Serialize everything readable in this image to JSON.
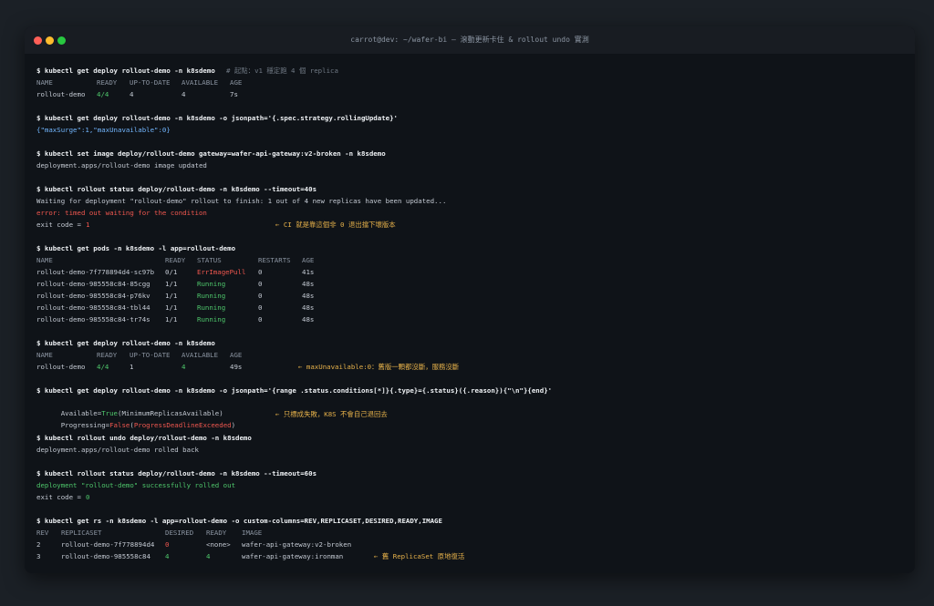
{
  "window": {
    "title": "carrot@dev: ~/wafer-bi — 滾動更新卡住 & rollout undo 實測"
  },
  "commands": {
    "c1": "$ kubectl get deploy rollout-demo -n k8sdemo",
    "c1_comment": "# 起點：v1 穩定跑 4 個 replica",
    "c2": "$ kubectl get deploy rollout-demo -n k8sdemo -o jsonpath='{.spec.strategy.rollingUpdate}'",
    "c3": "$ kubectl set image deploy/rollout-demo gateway=wafer-api-gateway:v2-broken -n k8sdemo",
    "c4": "$ kubectl rollout status deploy/rollout-demo -n k8sdemo --timeout=40s",
    "c5": "$ kubectl get pods -n k8sdemo -l app=rollout-demo",
    "c6": "$ kubectl get deploy rollout-demo -n k8sdemo",
    "c7": "$ kubectl get deploy rollout-demo -n k8sdemo -o jsonpath='{range .status.conditions[*]}{.type}={.status}({.reason}){\"\\n\"}{end}'",
    "c8": "$ kubectl rollout undo deploy/rollout-demo -n k8sdemo",
    "c9": "$ kubectl rollout status deploy/rollout-demo -n k8sdemo --timeout=60s",
    "c10": "$ kubectl get rs -n k8sdemo -l app=rollout-demo -o custom-columns=REV,REPLICASET,DESIRED,READY,IMAGE"
  },
  "deploy_table": {
    "headers": [
      "NAME",
      "READY",
      "UP-TO-DATE",
      "AVAILABLE",
      "AGE"
    ],
    "row1": [
      "rollout-demo",
      "4/4",
      "4",
      "4",
      "7s"
    ],
    "row2": [
      "rollout-demo",
      "4/4",
      "1",
      "4",
      "49s"
    ],
    "row2_annotation": "← maxUnavailable:0：舊版一顆都沒斷，服務沒斷"
  },
  "outputs": {
    "strategy_json": "{\"maxSurge\":1,\"maxUnavailable\":0}",
    "image_updated": "deployment.apps/rollout-demo image updated",
    "waiting": "Waiting for deployment \"rollout-demo\" rollout to finish: 1 out of 4 new replicas have been updated...",
    "error": "error: timed out waiting for the condition",
    "exit_label": "exit code = ",
    "exit1_value": "1",
    "exit1_annotation": "← CI 就是靠這個非 0 退出擋下壞版本",
    "cond_available_key": "Available=",
    "cond_available_status": "True",
    "cond_available_reason": "(MinimumReplicasAvailable)",
    "cond_progress_key": "Progressing=",
    "cond_progress_status": "False",
    "cond_progress_open": "(",
    "cond_progress_reason": "ProgressDeadlineExceeded",
    "cond_progress_close": ")",
    "cond_annotation": "← 只標成失敗，K8S 不會自己退回去",
    "rolled_back": "deployment.apps/rollout-demo rolled back",
    "rolled_out": "deployment \"rollout-demo\" successfully rolled out",
    "exit0_value": "0"
  },
  "pods_table": {
    "headers": [
      "NAME",
      "READY",
      "STATUS",
      "RESTARTS",
      "AGE"
    ],
    "rows": [
      [
        "rollout-demo-7f778894d4-sc97b",
        "0/1",
        "ErrImagePull",
        "0",
        "41s"
      ],
      [
        "rollout-demo-985558c84-85cgg",
        "1/1",
        "Running",
        "0",
        "48s"
      ],
      [
        "rollout-demo-985558c84-p76kv",
        "1/1",
        "Running",
        "0",
        "48s"
      ],
      [
        "rollout-demo-985558c84-tbl44",
        "1/1",
        "Running",
        "0",
        "48s"
      ],
      [
        "rollout-demo-985558c84-tr74s",
        "1/1",
        "Running",
        "0",
        "48s"
      ]
    ]
  },
  "rs_table": {
    "headers": [
      "REV",
      "REPLICASET",
      "DESIRED",
      "READY",
      "IMAGE"
    ],
    "rows": [
      [
        "2",
        "rollout-demo-7f778894d4",
        "0",
        "<none>",
        "wafer-api-gateway:v2-broken"
      ],
      [
        "3",
        "rollout-demo-985558c84",
        "4",
        "4",
        "wafer-api-gateway:ironman"
      ]
    ],
    "row2_annotation": "← 舊 ReplicaSet 原地復活"
  },
  "colors": {
    "green": "#4ec76b",
    "red": "#f0574f",
    "blue": "#73b7ff",
    "annotation": "#e6b14a"
  }
}
